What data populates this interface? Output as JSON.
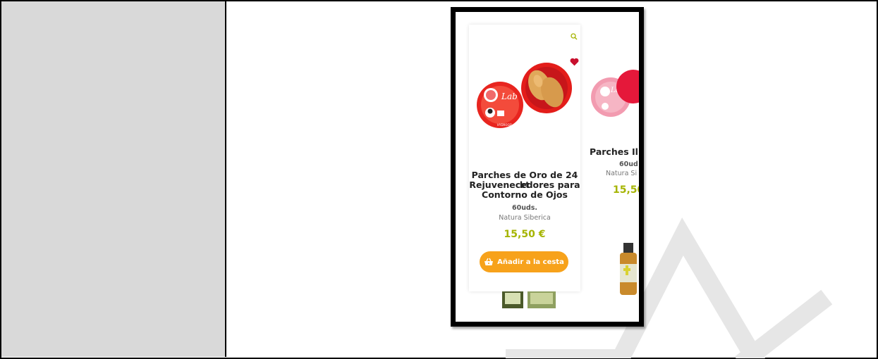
{
  "products": [
    {
      "name_lines": [
        "Parches de Oro de 24 kt",
        "Rejuvenecedores para",
        "Contorno de Ojos"
      ],
      "quantity": "60uds.",
      "brand": "Natura Siberica",
      "price": "15,50 €",
      "add_to_cart_label": "Añadir a la cesta",
      "image_icon": "eye-patches-jar-gold"
    },
    {
      "name": "Parches Ilu",
      "quantity": "60ud",
      "brand": "Natura Si",
      "price": "15,50",
      "image_icon": "eye-patches-jar-pink"
    }
  ],
  "icons": {
    "search": "search-icon",
    "wishlist": "heart-icon",
    "cart": "basket-icon"
  },
  "colors": {
    "price": "#a5b400",
    "cart_button": "#f7a21b",
    "wishlist": "#c8102e",
    "left_panel": "#d9d9d9"
  }
}
